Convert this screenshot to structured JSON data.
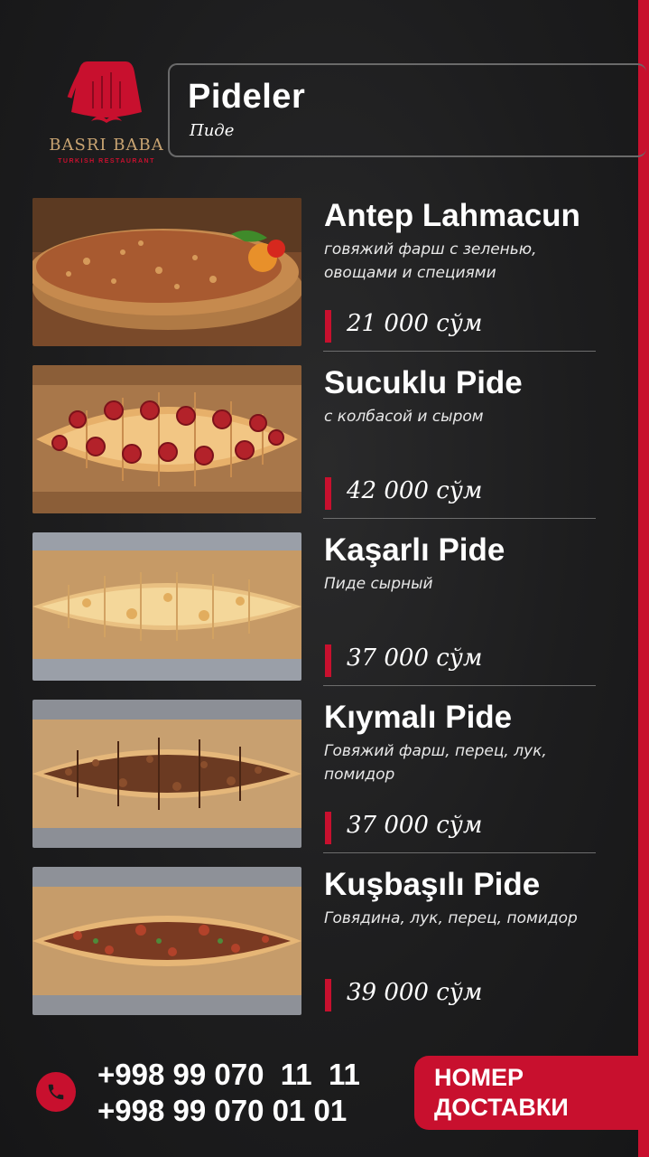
{
  "brand": {
    "name": "BASRI BABA",
    "tagline": "TURKISH RESTAURANT",
    "accent_color": "#c8102e",
    "gold_color": "#c9a472"
  },
  "header": {
    "title": "Pideler",
    "subtitle": "Пиде"
  },
  "items": [
    {
      "name": "Antep Lahmacun",
      "description": "говяжий фарш с зеленью, овощами и специями",
      "price": "21 000 сўм",
      "image": "round-lahmacun"
    },
    {
      "name": "Sucuklu Pide",
      "description": "с колбасой и сыром",
      "price": "42 000 сўм",
      "image": "pide-sausage"
    },
    {
      "name": "Kaşarlı Pide",
      "description": "Пиде сырный",
      "price": "37 000 сўм",
      "image": "pide-cheese"
    },
    {
      "name": "Kıymalı Pide",
      "description": "Говяжий фарш, перец, лук, помидор",
      "price": "37 000 сўм",
      "image": "pide-minced-meat"
    },
    {
      "name": " Kuşbaşılı Pide",
      "description": "Говядина, лук, перец, помидор",
      "price": "39 000 сўм",
      "image": "pide-beef-chunks"
    }
  ],
  "footer": {
    "phones": [
      "+998 99 070  11  11",
      "+998 99 070 01 01"
    ],
    "delivery_line1": "НОМЕР",
    "delivery_line2": "ДОСТАВКИ",
    "icon": "phone-icon"
  }
}
